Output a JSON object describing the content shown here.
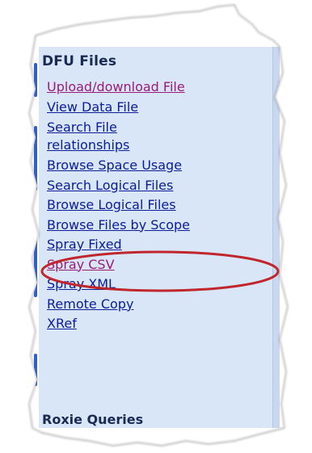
{
  "panel": {
    "title": "DFU Files",
    "items": [
      {
        "label": "Upload/download File",
        "visited": true
      },
      {
        "label": "View Data File",
        "visited": false
      },
      {
        "label": "Search File relationships",
        "visited": false,
        "multi": true
      },
      {
        "label": "Browse Space Usage",
        "visited": false
      },
      {
        "label": "Search Logical Files",
        "visited": false
      },
      {
        "label": "Browse Logical Files",
        "visited": false,
        "highlighted": true
      },
      {
        "label": "Browse Files by Scope",
        "visited": false
      },
      {
        "label": "Spray Fixed",
        "visited": false
      },
      {
        "label": "Spray CSV",
        "visited": true
      },
      {
        "label": "Spray XML",
        "visited": false
      },
      {
        "label": "Remote Copy",
        "visited": false
      },
      {
        "label": "XRef",
        "visited": false
      }
    ],
    "next_section_title": "Roxie Queries"
  },
  "colors": {
    "panel_bg": "#d8e6f7",
    "link": "#0b1d9a",
    "visited_link": "#9a1b7a",
    "highlight_ring": "#c0262c",
    "accent_bar": "#2c5fd0"
  }
}
